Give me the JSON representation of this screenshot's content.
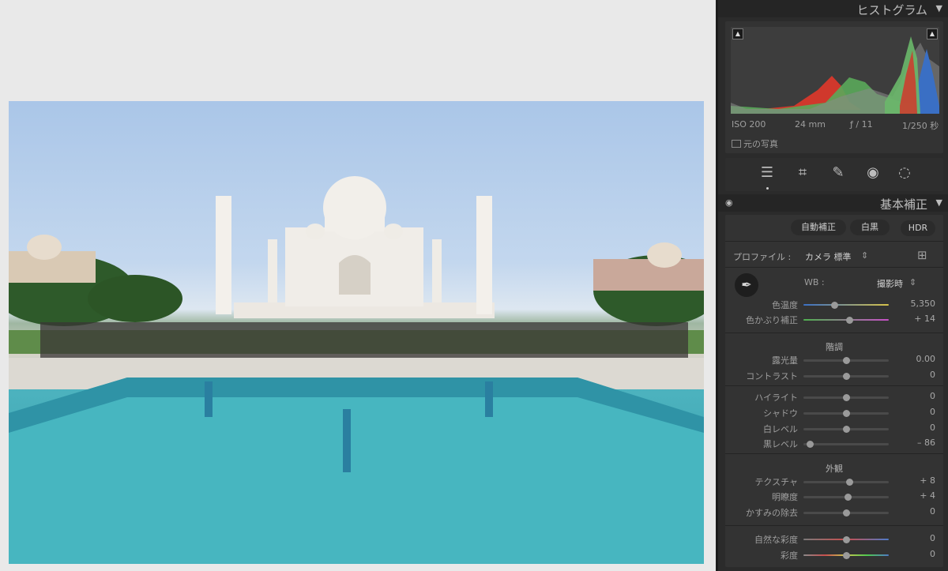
{
  "histogram": {
    "title": "ヒストグラム",
    "iso": "ISO 200",
    "focal": "24 mm",
    "aperture": "ƒ / 11",
    "shutter": "1/250 秒",
    "original_photo_label": "元の写真"
  },
  "tools": [
    "edit-icon",
    "crop-icon",
    "healing-icon",
    "redeye-icon",
    "masking-icon"
  ],
  "basic": {
    "title": "基本補正",
    "auto_label": "自動補正",
    "bw_label": "白黒",
    "hdr_label": "HDR",
    "profile_label": "プロファイル :",
    "profile_value": "カメラ 標準",
    "wb_label": "WB :",
    "wb_value": "撮影時",
    "tone_title": "階調",
    "presence_title": "外観",
    "sliders": {
      "temp": {
        "label": "色温度",
        "value": "5,350",
        "pos": 0.36
      },
      "tint": {
        "label": "色かぶり補正",
        "value": "+ 14",
        "pos": 0.54
      },
      "exposure": {
        "label": "露光量",
        "value": "0.00",
        "pos": 0.5
      },
      "contrast": {
        "label": "コントラスト",
        "value": "0",
        "pos": 0.5
      },
      "highlights": {
        "label": "ハイライト",
        "value": "0",
        "pos": 0.5
      },
      "shadows": {
        "label": "シャドウ",
        "value": "0",
        "pos": 0.5
      },
      "whites": {
        "label": "白レベル",
        "value": "0",
        "pos": 0.5
      },
      "blacks": {
        "label": "黒レベル",
        "value": "– 86",
        "pos": 0.07
      },
      "texture": {
        "label": "テクスチャ",
        "value": "+ 8",
        "pos": 0.54
      },
      "clarity": {
        "label": "明瞭度",
        "value": "+ 4",
        "pos": 0.52
      },
      "dehaze": {
        "label": "かすみの除去",
        "value": "0",
        "pos": 0.5
      },
      "vibrance": {
        "label": "自然な彩度",
        "value": "0",
        "pos": 0.5
      },
      "saturation": {
        "label": "彩度",
        "value": "0",
        "pos": 0.5
      }
    }
  },
  "colors": {
    "panel_bg": "#2b2b2b",
    "box_bg": "#333333",
    "text": "#cfcfcf",
    "histo_blue": "#3a6fc4",
    "histo_green": "#5aa85a",
    "histo_red": "#d0382c"
  }
}
